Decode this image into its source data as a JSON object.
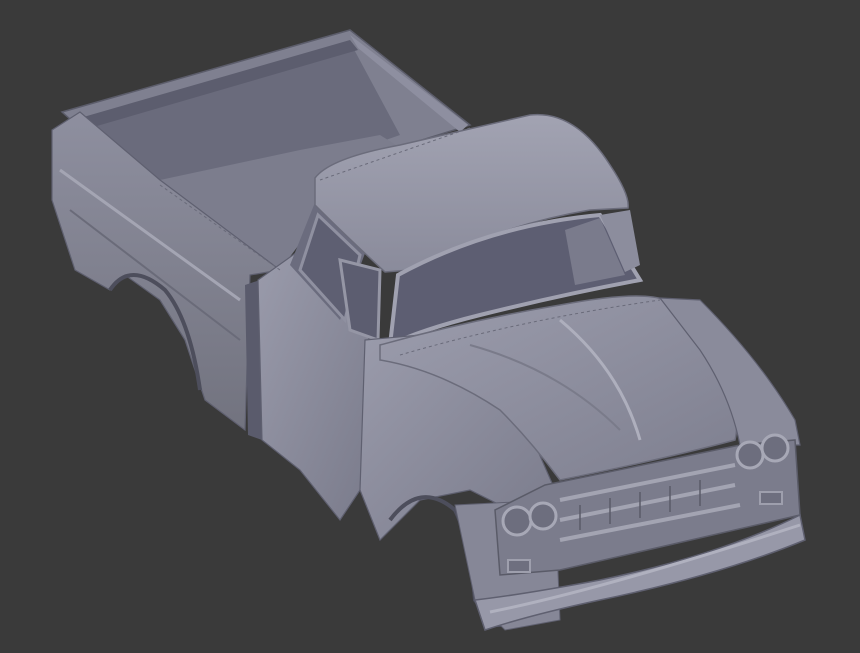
{
  "viewport": {
    "background_color": "#3a3a3a",
    "object_name": "pickup-truck-body-model",
    "object_color": "#8b8c9c",
    "object_shadow_color": "#5f6070",
    "object_highlight_color": "#a9aab8"
  }
}
